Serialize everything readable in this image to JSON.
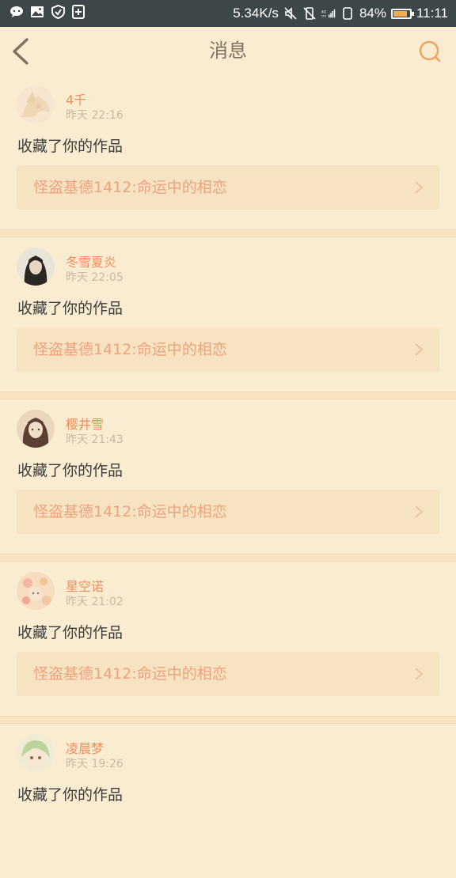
{
  "status_bar": {
    "network_speed": "5.34K/s",
    "network_type": "4G LTE",
    "battery_percent": "84%",
    "battery_level": 0.84,
    "time": "11:11",
    "left_icons": [
      "message-icon",
      "image-icon",
      "shield-icon",
      "plus-box-icon"
    ]
  },
  "header": {
    "title": "消息",
    "back_icon": "chevron-left-icon",
    "search_icon": "search-icon"
  },
  "colors": {
    "background": "#faecd0",
    "status_bar": "#3d4648",
    "username": "#f08e5c",
    "work_title": "#f0a17e",
    "title": "#806f62"
  },
  "messages": [
    {
      "username": "4千",
      "time": "昨天 22:16",
      "action": "收藏了你的作品",
      "work_title": "怪盗基德1412:命运中的相恋"
    },
    {
      "username": "冬雪夏炎",
      "time": "昨天 22:05",
      "action": "收藏了你的作品",
      "work_title": "怪盗基德1412:命运中的相恋"
    },
    {
      "username": "樱井雪",
      "time": "昨天 21:43",
      "action": "收藏了你的作品",
      "work_title": "怪盗基德1412:命运中的相恋"
    },
    {
      "username": "星空诺",
      "time": "昨天 21:02",
      "action": "收藏了你的作品",
      "work_title": "怪盗基德1412:命运中的相恋"
    },
    {
      "username": "凌晨梦",
      "time": "昨天 19:26",
      "action": "收藏了你的作品",
      "work_title": ""
    }
  ]
}
